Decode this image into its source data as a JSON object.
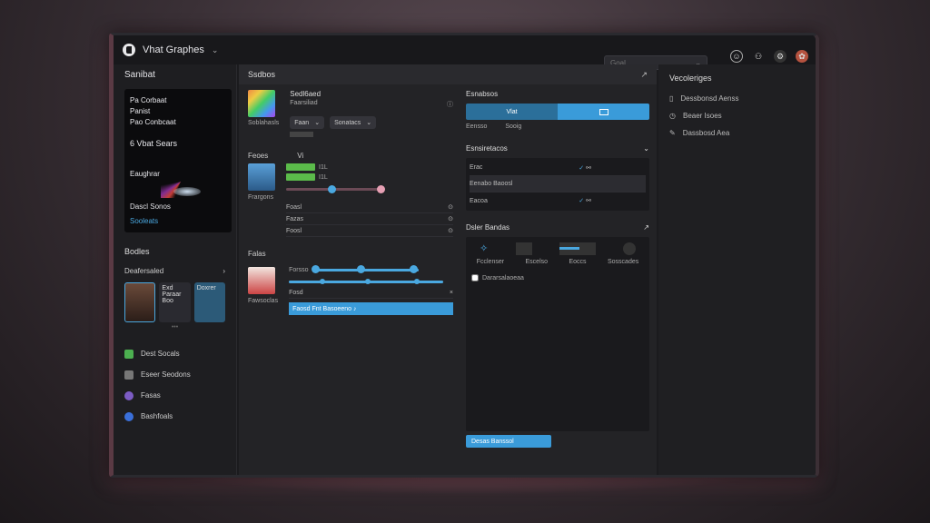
{
  "window": {
    "title": "Vhat Graphes",
    "chevron": "⌄"
  },
  "search": {
    "placeholder": "Goal",
    "dropdown": "⌄"
  },
  "topbar": {
    "icons": [
      "smiley-icon",
      "group-icon",
      "settings-icon",
      "avatar-icon"
    ]
  },
  "sidebar": {
    "title": "Sanibat",
    "hero": {
      "lines": [
        "Pa Corbaat",
        "Panist",
        "Pao Conbcaat",
        "6  Vbat  Sears",
        "Eaughrar"
      ],
      "item": "Dascl Sonos",
      "link": "Sooleats"
    },
    "section": "Bodles",
    "subsection": "Deafersaled",
    "subsection_arrow": "›",
    "cards": [
      {
        "kind": "portrait",
        "label": ""
      },
      {
        "kind": "plain",
        "label": "Exd Paraar Boo"
      },
      {
        "kind": "blue",
        "label": "Doxrer"
      }
    ],
    "scroll_hint": "•••",
    "list": [
      {
        "label": "Dest Socals",
        "color": "#4caf50"
      },
      {
        "label": "Eseer Seodons",
        "color": "#777777"
      },
      {
        "label": "Fasas",
        "color": "#7c5cc4"
      },
      {
        "label": "Bashfoals",
        "color": "#3a6fd9"
      }
    ]
  },
  "middle": {
    "header": "Ssdbos",
    "close": "↗",
    "layer": {
      "title": "Sedl6aed",
      "subtitle": "Faarsiliad",
      "thumb_caption": "Soblahasls",
      "dropdown1": "Faan",
      "dropdown2": "Sonatacs",
      "info": "ⓘ"
    },
    "bars": {
      "label": "Feoes",
      "suffix": "Vi",
      "v1": "I1L",
      "v2": "I1L"
    },
    "props": {
      "caption": "Frargons",
      "rows": [
        {
          "label": "Foasl",
          "icon": "⊙"
        },
        {
          "label": "Fazas",
          "icon": "⊙"
        },
        {
          "label": "Foosl",
          "icon": "⊙"
        }
      ]
    },
    "fades": {
      "label": "Falas",
      "caption": "Fawsoclas",
      "row1": "Forsso",
      "row2": "Fosd",
      "selected": "Faosd Fnt Basoeeno  ♪"
    },
    "styles": {
      "title": "Esnabsos",
      "tab1": "Vlat",
      "tab2": "",
      "sub1": "Eensso",
      "sub2": "Sooig"
    },
    "connect": {
      "title": "Esnsiretacos",
      "rows": [
        {
          "label": "Erac",
          "checked": true
        },
        {
          "label": "Eenabo Baoosl",
          "checked": false
        },
        {
          "label": "Eacoa",
          "checked": true
        }
      ]
    },
    "color": {
      "title": "Dsler Bandas",
      "labels": [
        "Fcclenser",
        "Escelso",
        "Eoccs",
        "Sosscades"
      ],
      "checkbox": "Dararsalaoeaa",
      "button": "Desas Banssol"
    }
  },
  "right": {
    "title": "Vecoleriges",
    "items": [
      {
        "label": "Dessbonsd Aenss",
        "icon": "file-icon"
      },
      {
        "label": "Beaer Isoes",
        "icon": "clock-icon"
      },
      {
        "label": "Dassbosd Aea",
        "icon": "brush-icon"
      }
    ]
  },
  "colors": {
    "accent": "#3a9bd9",
    "green": "#5bbb4a",
    "pink": "#e6a0b4"
  },
  "values": {
    "slider_top": 0.82,
    "slider_mid": [
      0.1,
      0.3,
      0.55,
      0.9
    ],
    "color_slider": 0.55
  }
}
